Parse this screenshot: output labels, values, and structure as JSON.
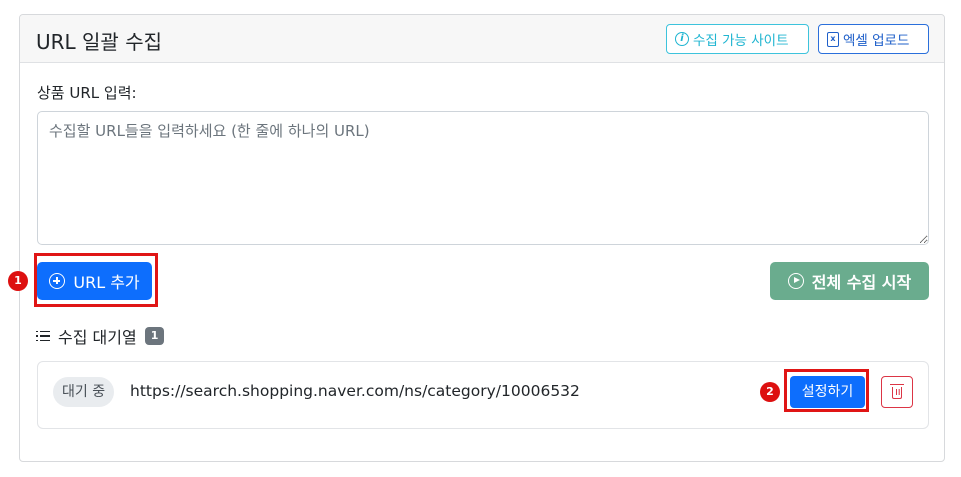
{
  "card": {
    "title": "URL 일괄 수집",
    "supported_sites_label": "수집 가능 사이트",
    "excel_upload_label": "엑셀 업로드"
  },
  "input": {
    "label": "상품 URL 입력:",
    "placeholder": "수집할 URL들을 입력하세요 (한 줄에 하나의 URL)",
    "value": ""
  },
  "actions": {
    "add_url_label": "URL 추가",
    "start_all_label": "전체 수집 시작"
  },
  "queue": {
    "title": "수집 대기열",
    "count": "1",
    "items": [
      {
        "status": "대기 중",
        "url": "https://search.shopping.naver.com/ns/category/10006532",
        "settings_label": "설정하기"
      }
    ]
  },
  "annotations": [
    "1",
    "2"
  ],
  "colors": {
    "primary": "#0d6efd",
    "success_muted": "#6aac8e",
    "info": "#1fb5d1",
    "danger": "#dc3545",
    "highlight": "#e01515"
  },
  "icons": {
    "supported_sites": "info-circle-icon",
    "excel_upload": "excel-file-icon",
    "add_url": "plus-circle-icon",
    "start_all": "play-circle-icon",
    "queue": "list-icon",
    "delete": "trash-icon"
  }
}
